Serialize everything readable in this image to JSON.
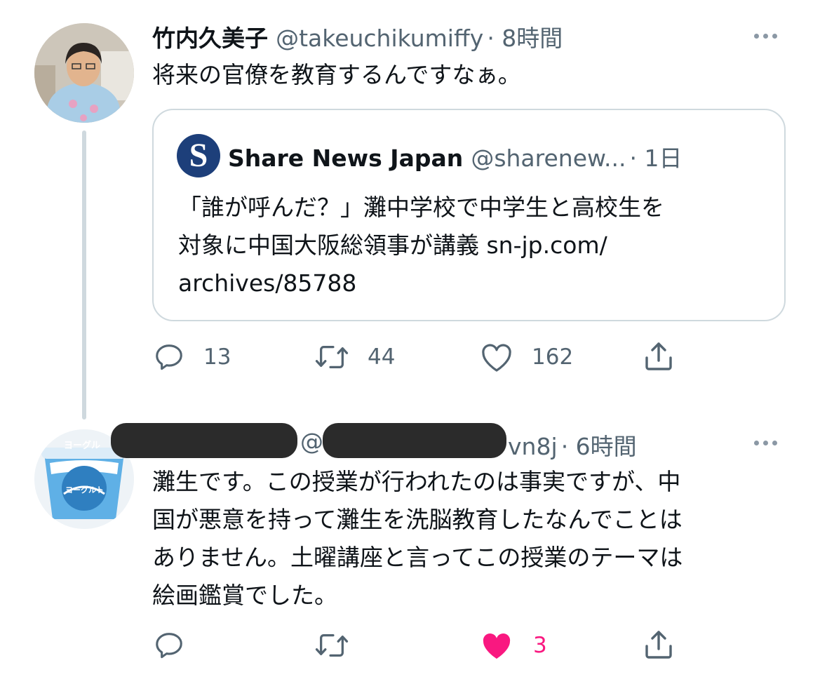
{
  "tweet1": {
    "display_name": "竹内久美子",
    "handle": "@takeuchikumiffy",
    "time": "· 8時間",
    "text": "将来の官僚を教育するんですなぁ。",
    "quote": {
      "logo_letter": "S",
      "name": "Share News Japan",
      "handle": "@sharenew...",
      "time": "· 1日",
      "lines": [
        "「誰が呼んだ？」灘中学校で中学生と高校生を",
        "対象に中国大阪総領事が講義 sn-jp.com/",
        "archives/85788"
      ]
    },
    "actions": {
      "replies": "13",
      "retweets": "44",
      "likes": "162"
    }
  },
  "tweet2": {
    "avatar_text_top": "ヨーグル",
    "avatar_text_badge": "ヨーグルト",
    "handle_prefix": "@",
    "handle_suffix": "vn8j",
    "time": "· 6時間",
    "lines": [
      "灘生です。この授業が行われたのは事実ですが、中",
      "国が悪意を持って灘生を洗脳教育したなんでことは",
      "ありません。土曜講座と言ってこの授業のテーマは",
      "絵画鑑賞でした。"
    ],
    "actions": {
      "likes": "3"
    }
  },
  "colors": {
    "like_active": "#f91880",
    "muted": "#536471",
    "logo_bg": "#1d3f7a"
  }
}
